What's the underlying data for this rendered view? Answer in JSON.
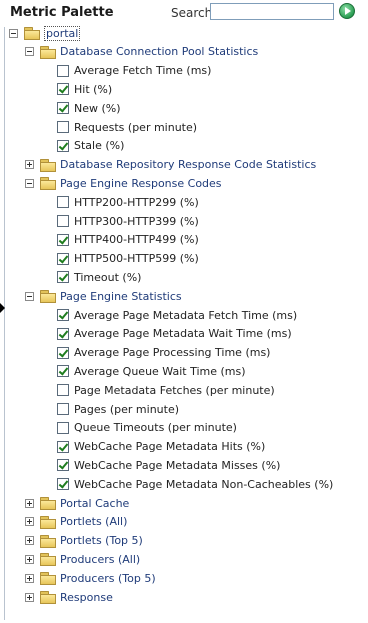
{
  "header": {
    "title": "Metric Palette",
    "search_label": "Search",
    "search_value": ""
  },
  "tree": {
    "root": "portal",
    "groups": [
      {
        "label": "Database Connection Pool Statistics",
        "expanded": true,
        "items": [
          {
            "label": "Average Fetch Time (ms)",
            "checked": false
          },
          {
            "label": "Hit (%)",
            "checked": true
          },
          {
            "label": "New (%)",
            "checked": true
          },
          {
            "label": "Requests (per minute)",
            "checked": false
          },
          {
            "label": "Stale (%)",
            "checked": true
          }
        ]
      },
      {
        "label": "Database Repository Response Code Statistics",
        "expanded": false,
        "items": []
      },
      {
        "label": "Page Engine Response Codes",
        "expanded": true,
        "items": [
          {
            "label": "HTTP200-HTTP299 (%)",
            "checked": false
          },
          {
            "label": "HTTP300-HTTP399 (%)",
            "checked": false
          },
          {
            "label": "HTTP400-HTTP499 (%)",
            "checked": true
          },
          {
            "label": "HTTP500-HTTP599 (%)",
            "checked": true
          },
          {
            "label": "Timeout (%)",
            "checked": true
          }
        ]
      },
      {
        "label": "Page Engine Statistics",
        "expanded": true,
        "items": [
          {
            "label": "Average Page Metadata Fetch Time (ms)",
            "checked": true
          },
          {
            "label": "Average Page Metadata Wait Time (ms)",
            "checked": true
          },
          {
            "label": "Average Page Processing Time (ms)",
            "checked": true
          },
          {
            "label": "Average Queue Wait Time (ms)",
            "checked": true
          },
          {
            "label": "Page Metadata Fetches (per minute)",
            "checked": false
          },
          {
            "label": "Pages (per minute)",
            "checked": false
          },
          {
            "label": "Queue Timeouts (per minute)",
            "checked": false
          },
          {
            "label": "WebCache Page Metadata Hits (%)",
            "checked": true
          },
          {
            "label": "WebCache Page Metadata Misses (%)",
            "checked": true
          },
          {
            "label": "WebCache Page Metadata Non-Cacheables (%)",
            "checked": true
          }
        ]
      },
      {
        "label": "Portal Cache",
        "expanded": false,
        "items": []
      },
      {
        "label": "Portlets (All)",
        "expanded": false,
        "items": []
      },
      {
        "label": "Portlets (Top 5)",
        "expanded": false,
        "items": []
      },
      {
        "label": "Producers (All)",
        "expanded": false,
        "items": []
      },
      {
        "label": "Producers (Top 5)",
        "expanded": false,
        "items": []
      },
      {
        "label": "Response",
        "expanded": false,
        "items": []
      }
    ]
  }
}
